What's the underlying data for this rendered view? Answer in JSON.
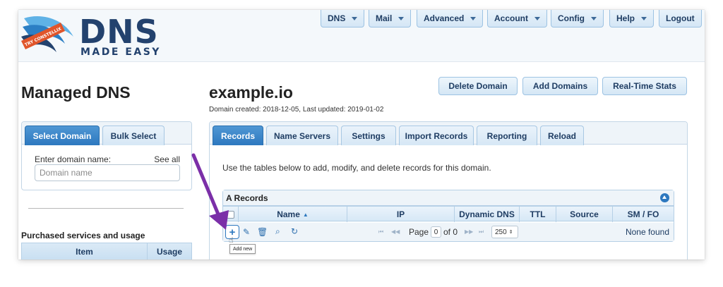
{
  "brand": {
    "name": "DNS",
    "tagline": "MADE EASY",
    "ribbon": "TRY CONSTELLIX"
  },
  "nav": [
    {
      "label": "DNS"
    },
    {
      "label": "Mail"
    },
    {
      "label": "Advanced"
    },
    {
      "label": "Account"
    },
    {
      "label": "Config"
    },
    {
      "label": "Help"
    },
    {
      "label": "Logout"
    }
  ],
  "left": {
    "title": "Managed DNS",
    "tabs": [
      "Select Domain",
      "Bulk Select"
    ],
    "enter_label": "Enter domain name:",
    "see_all": "See all",
    "domain_placeholder": "Domain name",
    "purchased_title": "Purchased services and usage",
    "usage_headers": [
      "Item",
      "Usage"
    ]
  },
  "main": {
    "domain": "example.io",
    "meta": "Domain created: 2018-12-05, Last updated: 2019-01-02",
    "actions": [
      "Delete Domain",
      "Add Domains",
      "Real-Time Stats"
    ],
    "tabs": [
      "Records",
      "Name Servers",
      "Settings",
      "Import Records",
      "Reporting",
      "Reload"
    ],
    "intro": "Use the tables below to add, modify, and delete records for this domain.",
    "section_title": "A Records",
    "columns": [
      "Name",
      "IP",
      "Dynamic DNS",
      "TTL",
      "Source",
      "SM / FO"
    ],
    "pager": {
      "page_label": "Page",
      "page_value": "0",
      "of_label": "of 0",
      "page_size": "250"
    },
    "none_found": "None found",
    "tooltip": "Add new"
  },
  "colors": {
    "accent": "#2d78bf",
    "brand_dark": "#23426e",
    "annotation": "#7b2fa8"
  }
}
